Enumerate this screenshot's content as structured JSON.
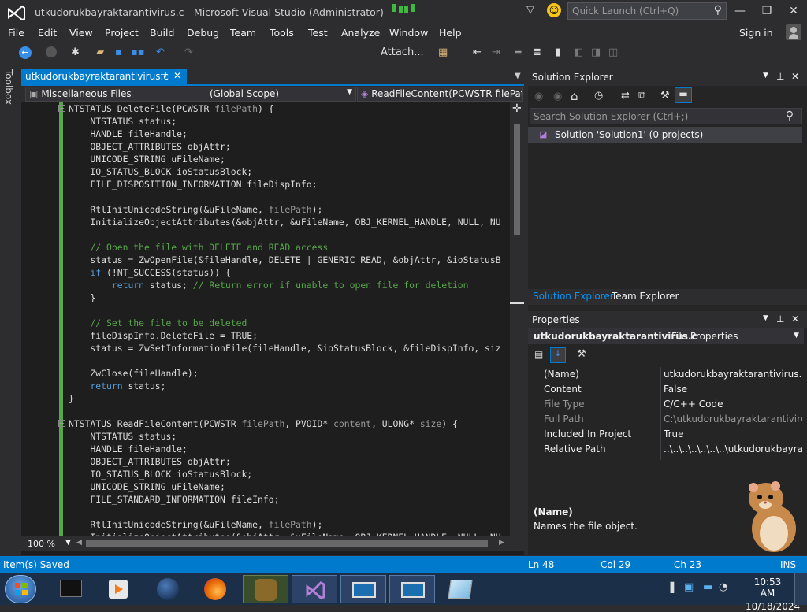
{
  "window": {
    "title": "utkudorukbayraktarantivirus.c - Microsoft Visual Studio (Administrator)",
    "quick_launch_placeholder": "Quick Launch (Ctrl+Q)"
  },
  "menu": {
    "items": [
      "File",
      "Edit",
      "View",
      "Project",
      "Build",
      "Debug",
      "Team",
      "Tools",
      "Test",
      "Analyze",
      "Window",
      "Help"
    ],
    "sign_in": "Sign in"
  },
  "toolbar": {
    "attach_label": "Attach..."
  },
  "toolbox": {
    "label": "Toolbox"
  },
  "editor": {
    "tab_label": "utkudorukbayraktarantivirus.c",
    "nav_project": "Miscellaneous Files",
    "nav_scope": "(Global Scope)",
    "nav_member": "ReadFileContent(PCWSTR filePat",
    "zoom": "100 %",
    "lines": [
      "NTSTATUS DeleteFile(PCWSTR filePath) {",
      "    NTSTATUS status;",
      "    HANDLE fileHandle;",
      "    OBJECT_ATTRIBUTES objAttr;",
      "    UNICODE_STRING uFileName;",
      "    IO_STATUS_BLOCK ioStatusBlock;",
      "    FILE_DISPOSITION_INFORMATION fileDispInfo;",
      "",
      "    RtlInitUnicodeString(&uFileName, filePath);",
      "    InitializeObjectAttributes(&objAttr, &uFileName, OBJ_KERNEL_HANDLE, NULL, NU",
      "",
      "    // Open the file with DELETE and READ access",
      "    status = ZwOpenFile(&fileHandle, DELETE | GENERIC_READ, &objAttr, &ioStatusB",
      "    if (!NT_SUCCESS(status)) {",
      "        return status; // Return error if unable to open file for deletion",
      "    }",
      "",
      "    // Set the file to be deleted",
      "    fileDispInfo.DeleteFile = TRUE;",
      "    status = ZwSetInformationFile(fileHandle, &ioStatusBlock, &fileDispInfo, siz",
      "",
      "    ZwClose(fileHandle);",
      "    return status;",
      "}",
      "",
      "NTSTATUS ReadFileContent(PCWSTR filePath, PVOID* content, ULONG* size) {",
      "    NTSTATUS status;",
      "    HANDLE fileHandle;",
      "    OBJECT_ATTRIBUTES objAttr;",
      "    IO_STATUS_BLOCK ioStatusBlock;",
      "    UNICODE_STRING uFileName;",
      "    FILE_STANDARD_INFORMATION fileInfo;",
      "",
      "    RtlInitUnicodeString(&uFileName, filePath);",
      "    InitializeObjectAttributes(&objAttr, &uFileName, OBJ_KERNEL_HANDLE, NULL, NU"
    ]
  },
  "solution_explorer": {
    "title": "Solution Explorer",
    "search_placeholder": "Search Solution Explorer (Ctrl+;)",
    "solution_node": "Solution 'Solution1' (0 projects)",
    "tab_solution": "Solution Explorer",
    "tab_team": "Team Explorer"
  },
  "properties": {
    "title": "Properties",
    "object_name": "utkudorukbayraktarantivirus.c",
    "object_type": "File Properties",
    "rows": [
      {
        "name": "(Name)",
        "value": "utkudorukbayraktarantivirus.c"
      },
      {
        "name": "Content",
        "value": "False"
      },
      {
        "name": "File Type",
        "value": "C/C++ Code"
      },
      {
        "name": "Full Path",
        "value": "C:\\utkudorukbayraktarantivirus\\u"
      },
      {
        "name": "Included In Project",
        "value": "True"
      },
      {
        "name": "Relative Path",
        "value": "..\\..\\..\\..\\..\\..\\..\\utkudorukbayral"
      }
    ],
    "desc_title": "(Name)",
    "desc_text": "Names the file object."
  },
  "status": {
    "message": "Item(s) Saved",
    "ln": "Ln 48",
    "col": "Col 29",
    "ch": "Ch 23",
    "mode": "INS"
  },
  "taskbar": {
    "time": "10:53 AM",
    "date": "10/18/2024"
  },
  "colors": {
    "accent": "#007acc",
    "keyword": "#569cd6",
    "comment": "#57a64a",
    "param": "#9b9b9b"
  }
}
